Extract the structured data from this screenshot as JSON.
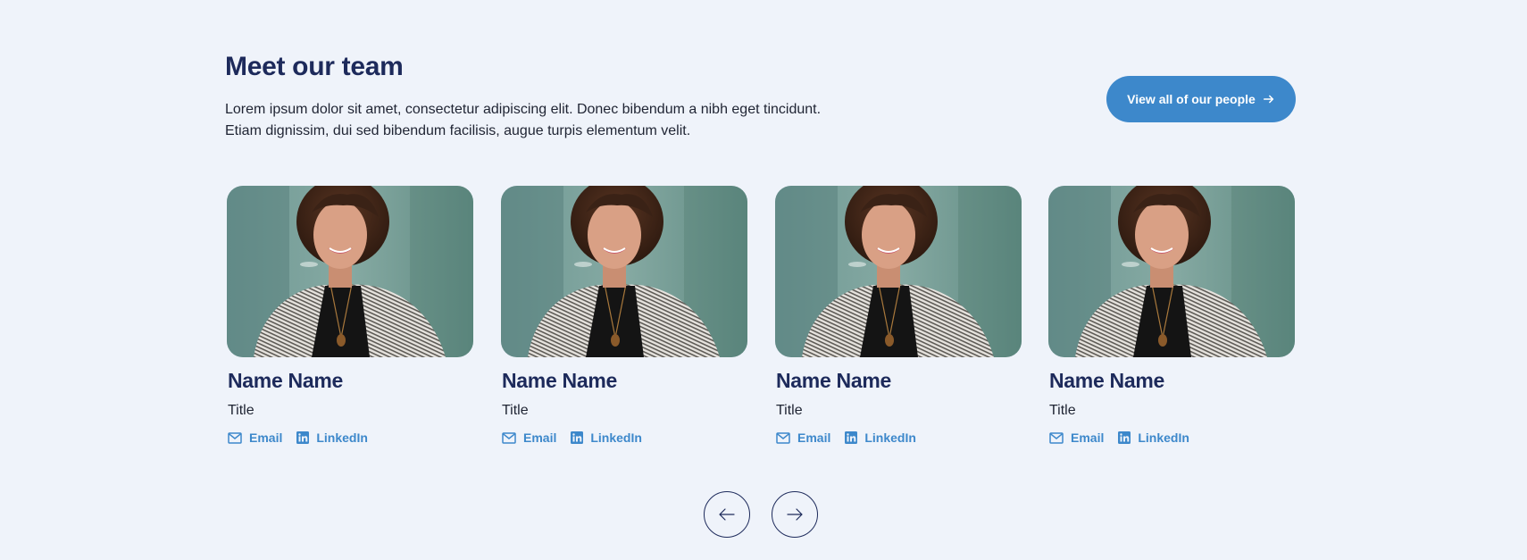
{
  "section": {
    "title": "Meet our team",
    "intro_line1": "Lorem ipsum dolor sit amet, consectetur adipiscing elit. Donec bibendum a nibh eget tincidunt.",
    "intro_line2": "Etiam dignissim, dui sed bibendum facilisis, augue turpis elementum velit.",
    "view_all_label": "View all of our people",
    "view_all_icon": "arrow-right-icon"
  },
  "team": [
    {
      "name": "Name Name",
      "title": "Title",
      "email_label": "Email",
      "linkedin_label": "LinkedIn"
    },
    {
      "name": "Name Name",
      "title": "Title",
      "email_label": "Email",
      "linkedin_label": "LinkedIn"
    },
    {
      "name": "Name Name",
      "title": "Title",
      "email_label": "Email",
      "linkedin_label": "LinkedIn"
    },
    {
      "name": "Name Name",
      "title": "Title",
      "email_label": "Email",
      "linkedin_label": "LinkedIn"
    }
  ],
  "carousel": {
    "prev_icon": "arrow-left-icon",
    "next_icon": "arrow-right-icon"
  },
  "colors": {
    "background": "#eff3fa",
    "heading": "#1d2a5b",
    "accent": "#3d88cb",
    "body_text": "#1f2433"
  }
}
